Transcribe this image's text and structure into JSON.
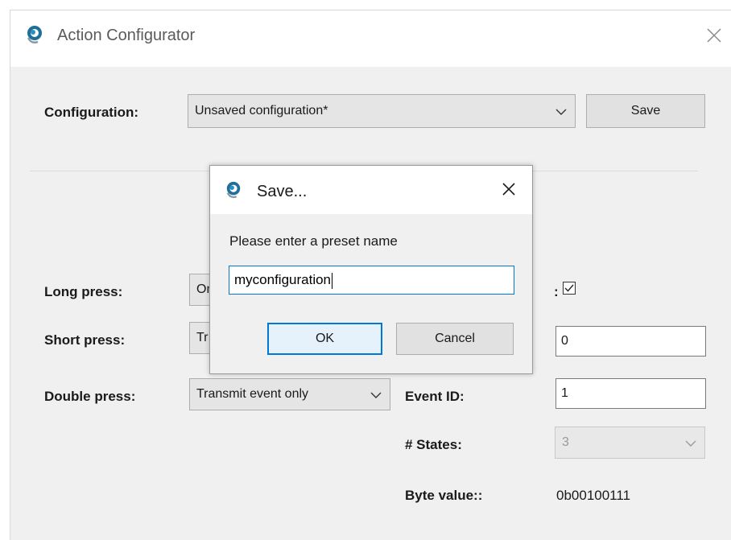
{
  "window": {
    "title": "Action Configurator"
  },
  "configuration": {
    "label": "Configuration:",
    "selected": "Unsaved configuration*",
    "save_label": "Save"
  },
  "left_panel": {
    "long_press": {
      "label": "Long press:",
      "value": "On"
    },
    "short_press": {
      "label": "Short press:",
      "value": "Tr"
    },
    "double_press": {
      "label": "Double press:",
      "value": "Transmit event only"
    }
  },
  "right_panel": {
    "checkbox_label_tail": ":",
    "checkbox_checked": true,
    "field1_value": "0",
    "event_id": {
      "label": "Event ID:",
      "value": "1"
    },
    "states": {
      "label": "# States:",
      "value": "3"
    },
    "byte_value": {
      "label": "Byte value::",
      "value": "0b00100111"
    }
  },
  "dialog": {
    "title": "Save...",
    "prompt": "Please enter a preset name",
    "input_value": "myconfiguration",
    "ok_label": "OK",
    "cancel_label": "Cancel"
  },
  "colors": {
    "accent": "#0078d7",
    "window_bg": "#f0f0f0",
    "icon_blue": "#1f6f99"
  },
  "icons": [
    "app-logo-icon",
    "close-icon",
    "chevron-down-icon",
    "checkmark-icon"
  ]
}
